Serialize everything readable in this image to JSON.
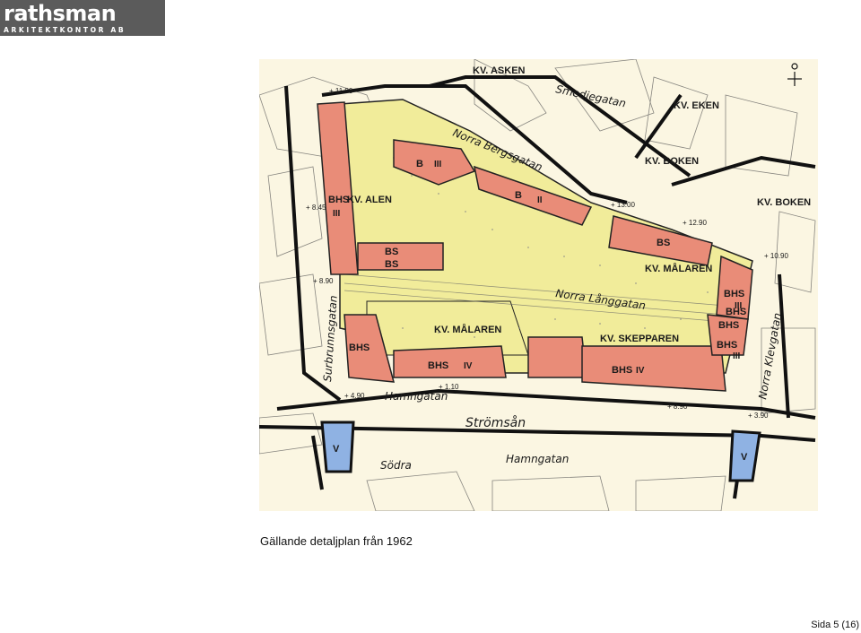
{
  "header": {
    "brand": "rathsman",
    "subtitle": "ARKITEKTKONTOR AB"
  },
  "map": {
    "blocks": [
      "KV. ASKEN",
      "KV. EKEN",
      "KV. BOKEN",
      "KV. BOKEN",
      "KV. ALEN",
      "KV. MÅLAREN",
      "KV. MÅLAREN",
      "KV. SKEPPAREN"
    ],
    "streets": [
      "Smedjegatan",
      "Norra Bergsgatan",
      "Norra Långgatan",
      "Surbrunnsgatan",
      "Hamngatan",
      "Strömsån",
      "Södra",
      "Hamngatan",
      "Norra Klevgatan"
    ],
    "zones": [
      "BHS",
      "BHS",
      "BHS",
      "BHS",
      "BHS",
      "BHS",
      "BHS",
      "B",
      "B",
      "BS",
      "BS",
      "BS",
      "BHS",
      "V",
      "V"
    ],
    "floors": [
      "III",
      "III",
      "II",
      "IV",
      "IV",
      "III",
      "III"
    ],
    "heights": [
      "+ 11.90",
      "+ 13.00",
      "+ 12.90",
      "+ 10.90",
      "+ 8.45",
      "+ 8.90",
      "+ 1.10",
      "+ 8.90",
      "+ 3.90",
      "+ 4.90"
    ],
    "colors": {
      "red": "#e98c78",
      "yellow": "#f1ec9a",
      "blue": "#8fb2e3",
      "ink": "#1c1c1c"
    }
  },
  "caption": "Gällande detaljplan från 1962",
  "page": "Sida 5 (16)"
}
